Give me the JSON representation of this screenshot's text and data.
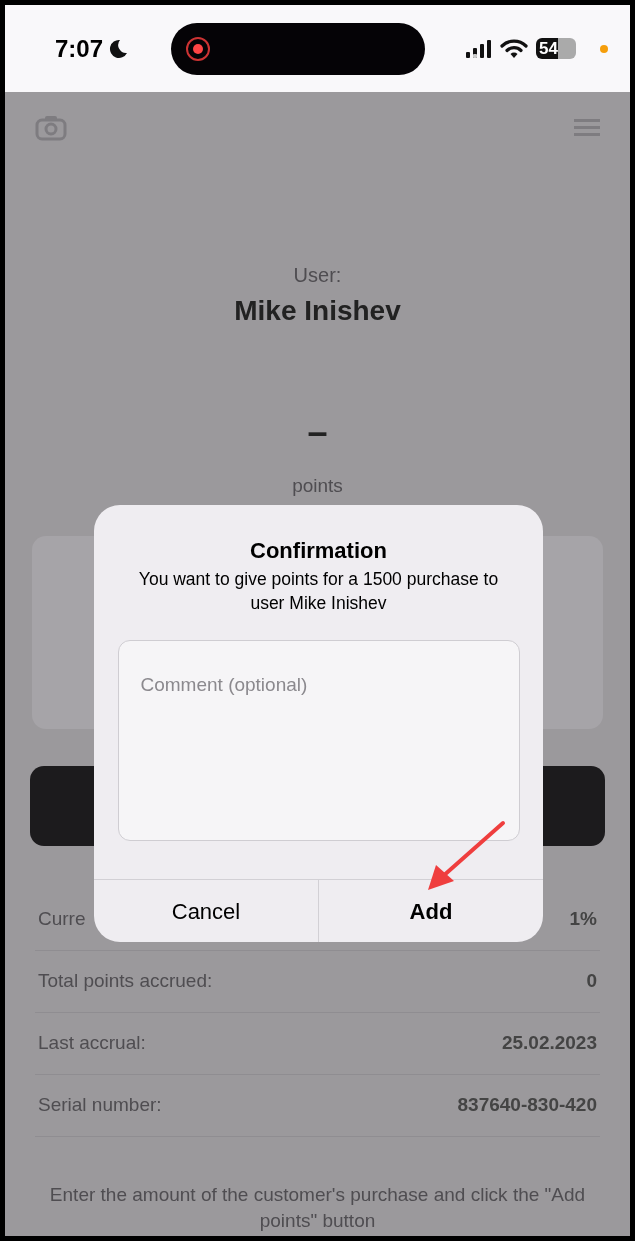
{
  "status_bar": {
    "time": "7:07",
    "battery": "54"
  },
  "user": {
    "label": "User:",
    "name": "Mike Inishev"
  },
  "points": {
    "value": "–",
    "label": "points"
  },
  "stats": [
    {
      "label": "Curre",
      "value": "1%"
    },
    {
      "label": "Total points accrued:",
      "value": "0"
    },
    {
      "label": "Last accrual:",
      "value": "25.02.2023"
    },
    {
      "label": "Serial number:",
      "value": "837640-830-420"
    }
  ],
  "hint": "Enter the amount of the customer's purchase and click the \"Add points\" button",
  "dialog": {
    "title": "Confirmation",
    "message": "You want to give points for a 1500 purchase to user Mike Inishev",
    "comment": {
      "placeholder": "Comment (optional)"
    },
    "buttons": [
      {
        "label": "Cancel",
        "kind": "cancel"
      },
      {
        "label": "Add",
        "kind": "default"
      }
    ]
  }
}
